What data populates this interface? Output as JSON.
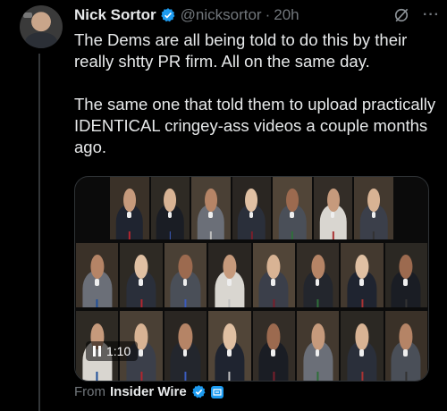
{
  "tweet": {
    "author_name": "Nick Sortor",
    "handle": "@nicksortor",
    "separator": "·",
    "time": "20h",
    "more_label": "···",
    "paragraph_1": "The Dems are all being told to do this by their really shtty PR firm. All on the same day.",
    "paragraph_2": "The same one that told them to upload practically IDENTICAL cringey-ass videos a couple months ago.",
    "video_duration": "1:10",
    "source_prefix": "From",
    "source_name": "Insider Wire"
  },
  "colors": {
    "background": "#000000",
    "text": "#e7e9ea",
    "muted": "#71767b",
    "verified": "#1d9bf0",
    "border": "#2f3336"
  },
  "icons": {
    "verified": "verified-badge-icon",
    "grok": "slash-circle-icon",
    "more": "more-icon",
    "pause": "pause-icon",
    "affiliate": "affiliate-badge-icon"
  }
}
